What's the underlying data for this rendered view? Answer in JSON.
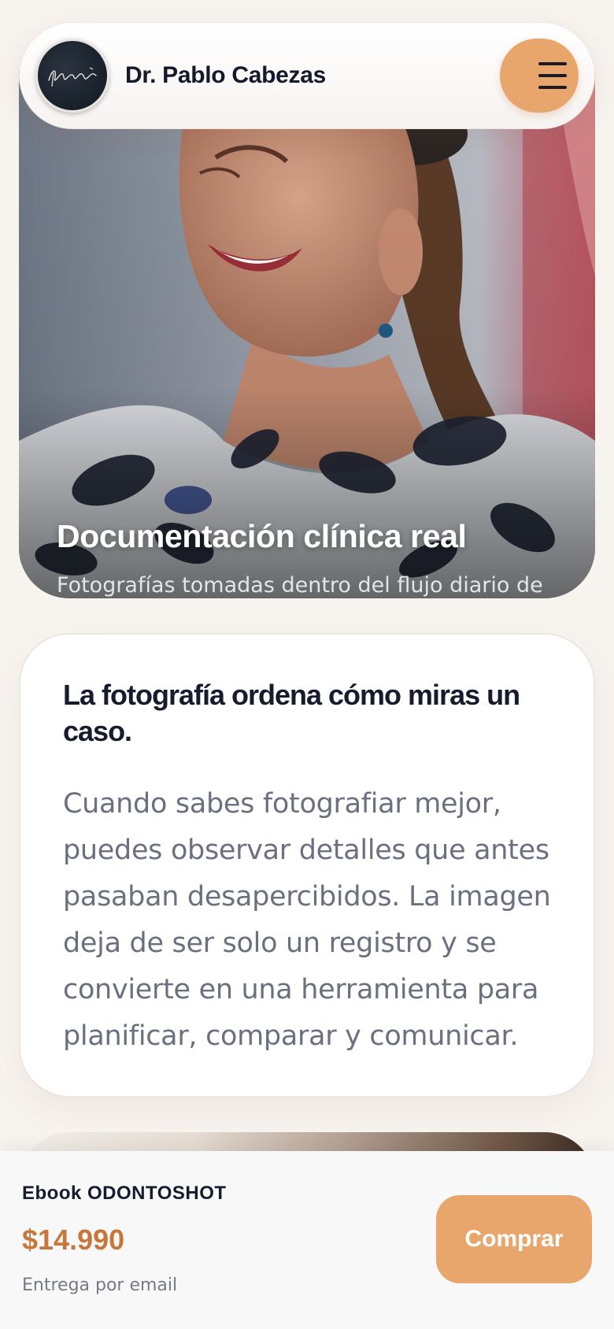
{
  "header": {
    "brand": "Dr. Pablo Cabezas",
    "avatar_signature": "PabloCabezasF",
    "menu_icon": "hamburger-menu-icon"
  },
  "hero": {
    "title": "Documentación clínica real",
    "subtitle": "Fotografías tomadas dentro del flujo diario de atención."
  },
  "intro_card": {
    "heading": "La fotografía ordena cómo miras un caso.",
    "body": "Cuando sabes fotografiar mejor, puedes observar detalles que antes pasaban desapercibidos. La imagen deja de ser solo un registro y se convierte en una herramienta para planificar, comparar y comunicar."
  },
  "purchase_bar": {
    "product": "Ebook ODONTOSHOT",
    "price": "$14.990",
    "note": "Entrega por email",
    "button_label": "Comprar"
  },
  "colors": {
    "accent": "#e9a66c",
    "price": "#c7773b",
    "text_dark": "#161b2e",
    "text_muted": "#6b7080",
    "background": "#f7f3ef"
  }
}
